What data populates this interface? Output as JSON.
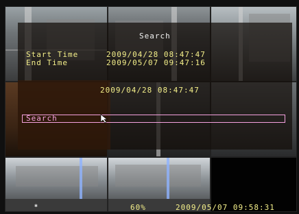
{
  "dialog": {
    "title": "Search",
    "start_label": "Start Time",
    "start_value": "2009/04/28 08:47:47",
    "end_label": "End Time",
    "end_value": "2009/05/07 09:47:16",
    "current_value": "2009/04/28 08:47:47",
    "search_label": "Search"
  },
  "status": {
    "left_text": "60%",
    "time_text": "2009/05/07 09:58:31"
  },
  "colors": {
    "text_white": "#f2f2f2",
    "text_yellow": "#f4ef8a",
    "highlight_pink": "#f6a2e0",
    "panel_bg": "#140e0a"
  },
  "icons": {
    "pointer": "mouse-cursor-icon",
    "marker": "camera-marker-icon"
  }
}
